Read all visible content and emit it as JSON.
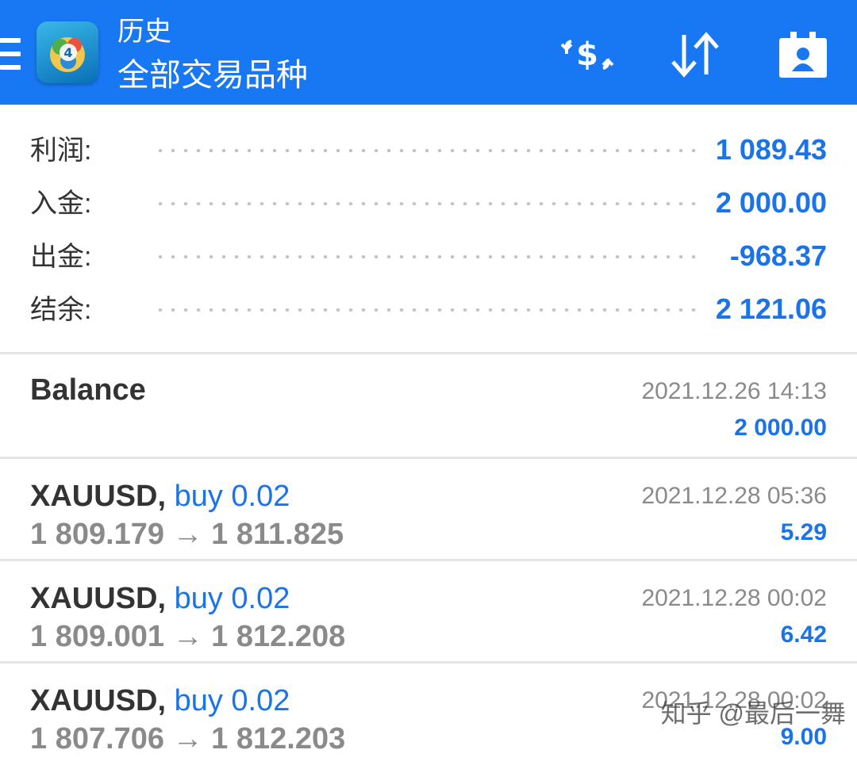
{
  "topbar": {
    "title_small": "历史",
    "title_big": "全部交易品种",
    "icons": [
      "menu-icon",
      "app-logo",
      "currency-exchange-icon",
      "sort-icon",
      "account-icon"
    ],
    "color": "#1877f2"
  },
  "summary": [
    {
      "label": "利润:",
      "value": "1 089.43"
    },
    {
      "label": "入金:",
      "value": "2 000.00"
    },
    {
      "label": "出金:",
      "value": "-968.37"
    },
    {
      "label": "结余:",
      "value": "2 121.06"
    }
  ],
  "balance": {
    "label": "Balance",
    "date": "2021.12.26 14:13",
    "amount": "2 000.00"
  },
  "trades": [
    {
      "symbol": "XAUUSD,",
      "action": "buy 0.02",
      "prices": "1 809.179 → 1 811.825",
      "date": "2021.12.28 05:36",
      "profit": "5.29"
    },
    {
      "symbol": "XAUUSD,",
      "action": "buy 0.02",
      "prices": "1 809.001 → 1 812.208",
      "date": "2021.12.28 00:02",
      "profit": "6.42"
    },
    {
      "symbol": "XAUUSD,",
      "action": "buy 0.02",
      "prices": "1 807.706 → 1 812.203",
      "date": "2021.12.28 00:02",
      "profit": "9.00"
    }
  ],
  "watermark": "知乎 @最后一舞",
  "colors": {
    "accent": "#1a73e8",
    "muted": "#8a8a8a",
    "text": "#333333"
  }
}
